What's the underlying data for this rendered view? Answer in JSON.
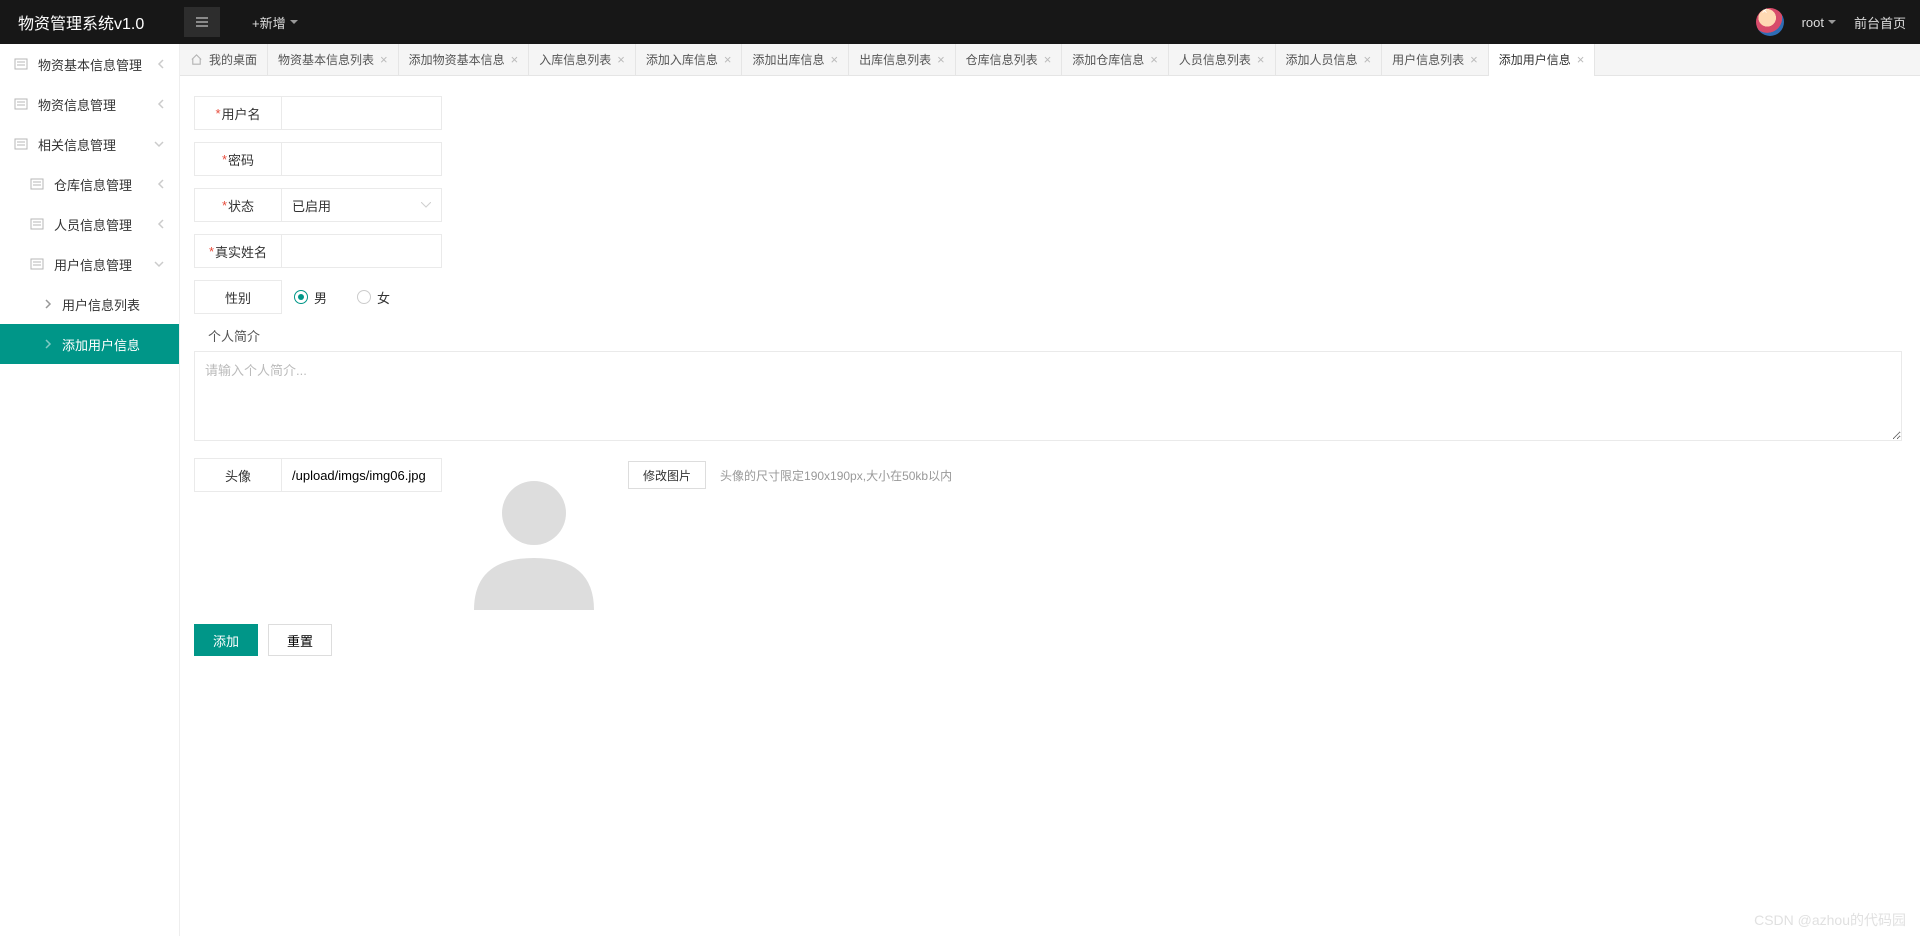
{
  "header": {
    "title": "物资管理系统v1.0",
    "new_add": "+新增",
    "username": "root",
    "front_link": "前台首页"
  },
  "sidebar": {
    "items": [
      {
        "label": "物资基本信息管理",
        "arrow": "left"
      },
      {
        "label": "物资信息管理",
        "arrow": "left"
      },
      {
        "label": "相关信息管理",
        "arrow": "down"
      }
    ],
    "sub_items": [
      {
        "label": "仓库信息管理",
        "arrow": "left"
      },
      {
        "label": "人员信息管理",
        "arrow": "left"
      },
      {
        "label": "用户信息管理",
        "arrow": "down"
      }
    ],
    "sub2_items": [
      {
        "label": "用户信息列表",
        "active": false
      },
      {
        "label": "添加用户信息",
        "active": true
      }
    ]
  },
  "tabs": [
    {
      "label": "我的桌面",
      "home": true,
      "closable": false
    },
    {
      "label": "物资基本信息列表",
      "closable": true
    },
    {
      "label": "添加物资基本信息",
      "closable": true
    },
    {
      "label": "入库信息列表",
      "closable": true
    },
    {
      "label": "添加入库信息",
      "closable": true
    },
    {
      "label": "添加出库信息",
      "closable": true
    },
    {
      "label": "出库信息列表",
      "closable": true
    },
    {
      "label": "仓库信息列表",
      "closable": true
    },
    {
      "label": "添加仓库信息",
      "closable": true
    },
    {
      "label": "人员信息列表",
      "closable": true
    },
    {
      "label": "添加人员信息",
      "closable": true
    },
    {
      "label": "用户信息列表",
      "closable": true
    },
    {
      "label": "添加用户信息",
      "closable": true,
      "active": true
    }
  ],
  "form": {
    "username_label": "用户名",
    "username_value": "",
    "password_label": "密码",
    "password_value": "",
    "status_label": "状态",
    "status_value": "已启用",
    "realname_label": "真实姓名",
    "realname_value": "",
    "gender_label": "性别",
    "gender_male": "男",
    "gender_female": "女",
    "bio_label": "个人简介",
    "bio_placeholder": "请输入个人简介...",
    "avatar_label": "头像",
    "avatar_path": "/upload/imgs/img06.jpg",
    "modify_btn": "修改图片",
    "avatar_hint": "头像的尺寸限定190x190px,大小在50kb以内",
    "submit_btn": "添加",
    "reset_btn": "重置"
  },
  "watermark": "CSDN @azhou的代码园"
}
